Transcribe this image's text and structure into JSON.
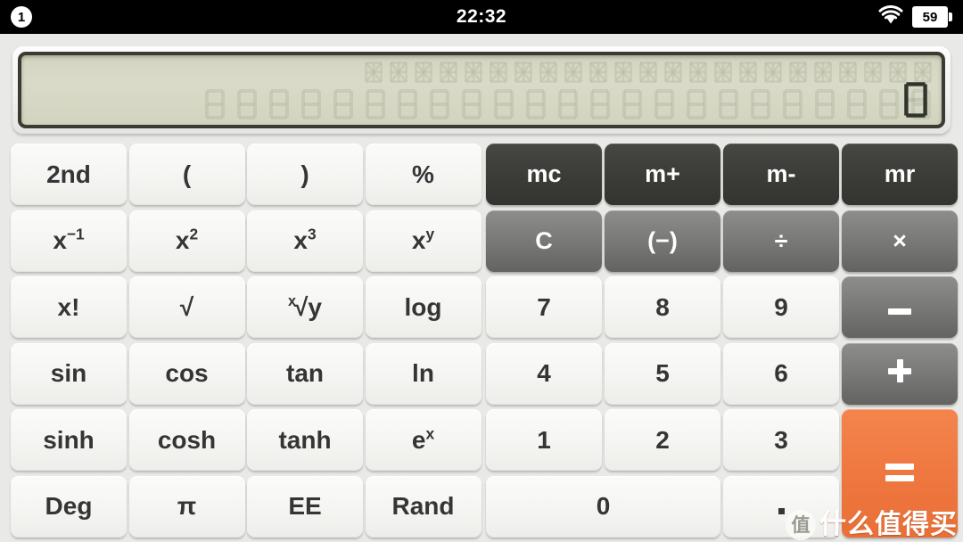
{
  "status_bar": {
    "sim_indicator": "1",
    "time": "22:32",
    "wifi_icon": "wifi-icon",
    "battery_level": "59"
  },
  "display": {
    "value": "0",
    "ghost_top_count": 23,
    "ghost_bottom_count": 23,
    "lcd_color": "#d6d8c4",
    "bezel_color": "#3b3b33"
  },
  "colors": {
    "body": "#e9e9e7",
    "key_light": "#f6f6f4",
    "key_dark": "#3b3b38",
    "key_gray": "#7b7b7a",
    "key_orange": "#ef7840",
    "text_dark": "#353535"
  },
  "keypad": {
    "rows": [
      [
        {
          "name": "key-2nd",
          "label": "2nd",
          "style": "light"
        },
        {
          "name": "key-paren-open",
          "label": "(",
          "style": "light"
        },
        {
          "name": "key-paren-close",
          "label": ")",
          "style": "light"
        },
        {
          "name": "key-percent",
          "label": "%",
          "style": "light"
        },
        {
          "name": "key-mc",
          "label": "mc",
          "style": "dark"
        },
        {
          "name": "key-m-plus",
          "label": "m+",
          "style": "dark"
        },
        {
          "name": "key-m-minus",
          "label": "m-",
          "style": "dark"
        },
        {
          "name": "key-mr",
          "label": "mr",
          "style": "dark"
        }
      ],
      [
        {
          "name": "key-x-inverse",
          "label": "x⁻¹",
          "style": "light"
        },
        {
          "name": "key-x-squared",
          "label": "x²",
          "style": "light"
        },
        {
          "name": "key-x-cubed",
          "label": "x³",
          "style": "light"
        },
        {
          "name": "key-x-power-y",
          "label": "xʸ",
          "style": "light"
        },
        {
          "name": "key-clear",
          "label": "C",
          "style": "gray"
        },
        {
          "name": "key-negate",
          "label": "(−)",
          "style": "gray"
        },
        {
          "name": "key-divide",
          "label": "÷",
          "style": "gray"
        },
        {
          "name": "key-multiply",
          "label": "×",
          "style": "gray"
        }
      ],
      [
        {
          "name": "key-factorial",
          "label": "x!",
          "style": "light"
        },
        {
          "name": "key-sqrt",
          "label": "√",
          "style": "light"
        },
        {
          "name": "key-nth-root",
          "label": "ˣ√y",
          "style": "light"
        },
        {
          "name": "key-log",
          "label": "log",
          "style": "light"
        },
        {
          "name": "key-7",
          "label": "7",
          "style": "light"
        },
        {
          "name": "key-8",
          "label": "8",
          "style": "light"
        },
        {
          "name": "key-9",
          "label": "9",
          "style": "light"
        },
        {
          "name": "key-subtract",
          "label": "−",
          "style": "gray"
        }
      ],
      [
        {
          "name": "key-sin",
          "label": "sin",
          "style": "light"
        },
        {
          "name": "key-cos",
          "label": "cos",
          "style": "light"
        },
        {
          "name": "key-tan",
          "label": "tan",
          "style": "light"
        },
        {
          "name": "key-ln",
          "label": "ln",
          "style": "light"
        },
        {
          "name": "key-4",
          "label": "4",
          "style": "light"
        },
        {
          "name": "key-5",
          "label": "5",
          "style": "light"
        },
        {
          "name": "key-6",
          "label": "6",
          "style": "light"
        },
        {
          "name": "key-add",
          "label": "+",
          "style": "gray"
        }
      ],
      [
        {
          "name": "key-sinh",
          "label": "sinh",
          "style": "light"
        },
        {
          "name": "key-cosh",
          "label": "cosh",
          "style": "light"
        },
        {
          "name": "key-tanh",
          "label": "tanh",
          "style": "light"
        },
        {
          "name": "key-e-power-x",
          "label": "eˣ",
          "style": "light"
        },
        {
          "name": "key-1",
          "label": "1",
          "style": "light"
        },
        {
          "name": "key-2",
          "label": "2",
          "style": "light"
        },
        {
          "name": "key-3",
          "label": "3",
          "style": "light"
        },
        {
          "name": "key-equals",
          "label": "=",
          "style": "orange"
        }
      ],
      [
        {
          "name": "key-deg",
          "label": "Deg",
          "style": "light"
        },
        {
          "name": "key-pi",
          "label": "π",
          "style": "light"
        },
        {
          "name": "key-ee",
          "label": "EE",
          "style": "light"
        },
        {
          "name": "key-rand",
          "label": "Rand",
          "style": "light"
        },
        {
          "name": "key-0",
          "label": "0",
          "style": "light"
        },
        {
          "name": "key-decimal",
          "label": "·",
          "style": "light"
        }
      ]
    ]
  },
  "watermark": {
    "logo": "值",
    "text": "什么值得买"
  }
}
